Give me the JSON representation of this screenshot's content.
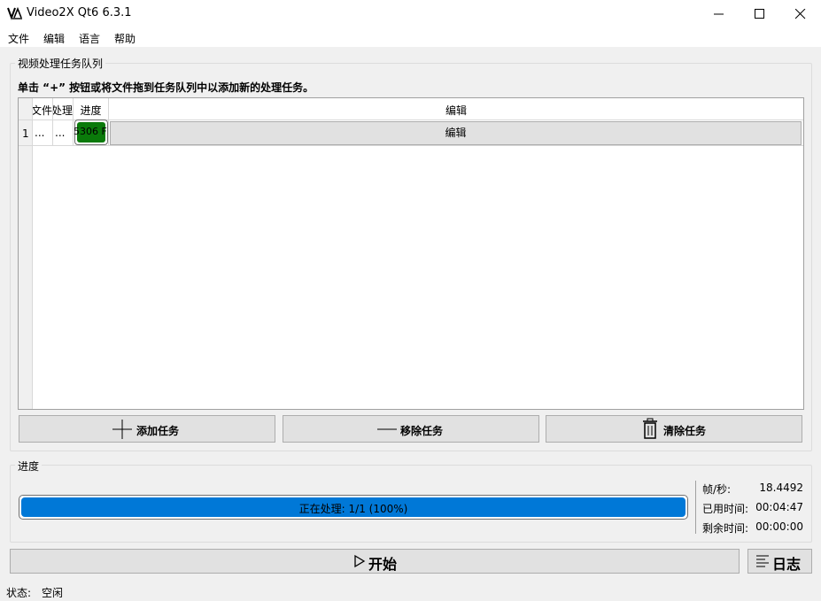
{
  "window": {
    "title": "Video2X Qt6 6.3.1"
  },
  "menu": {
    "items": [
      "文件",
      "编辑",
      "语言",
      "帮助"
    ]
  },
  "queue": {
    "group_title": "视频处理任务队列",
    "hint": "单击 “+” 按钮或将文件拖到任务队列中以添加新的处理任务。",
    "headers": {
      "file": "文件",
      "process": "处理",
      "progress": "进度",
      "edit": "编辑"
    },
    "rows": [
      {
        "index": "1",
        "file": "...",
        "process": "...",
        "progress_text": "5306 F",
        "progress_fraction": 1.0,
        "edit": "编辑"
      }
    ],
    "buttons": {
      "add": "添加任务",
      "remove": "移除任务",
      "clear": "清除任务"
    }
  },
  "progress": {
    "group_title": "进度",
    "bar_text": "正在处理: 1/1 (100%)",
    "fraction": 1.0,
    "stats": [
      {
        "label": "帧/秒:",
        "value": "18.4492"
      },
      {
        "label": "已用时间:",
        "value": "00:04:47"
      },
      {
        "label": "剩余时间:",
        "value": "00:00:00"
      }
    ]
  },
  "actions": {
    "start": "开始",
    "log": "日志"
  },
  "status": {
    "label": "状态:",
    "value": "空闲"
  },
  "colors": {
    "progress_blue": "#0078d7",
    "row_progress_green": "#0a7a0a"
  }
}
